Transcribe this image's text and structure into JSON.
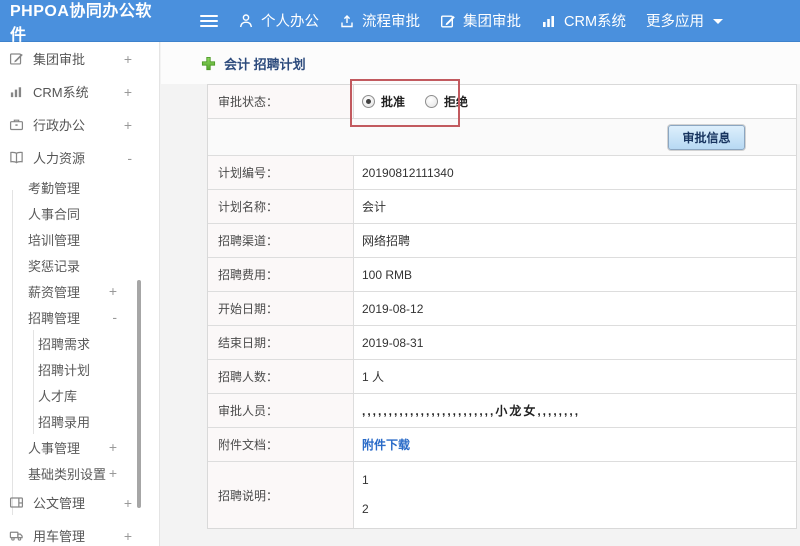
{
  "colors": {
    "header_blue": "#4a90dd",
    "annotation_red": "#c25a5f",
    "link_blue": "#2a6bc8",
    "button_text": "#17345f"
  },
  "header": {
    "logo": "PHPOA协同办公软件",
    "nav": [
      {
        "label": "个人办公",
        "icon": "user-icon"
      },
      {
        "label": "流程审批",
        "icon": "workflow-icon"
      },
      {
        "label": "集团审批",
        "icon": "edit-icon"
      },
      {
        "label": "CRM系统",
        "icon": "barchart-icon"
      },
      {
        "label": "更多应用",
        "icon": "caret-down-icon"
      }
    ]
  },
  "sidebar": {
    "items": [
      {
        "label": "集团审批",
        "icon": "edit-icon",
        "toggle": "+"
      },
      {
        "label": "CRM系统",
        "icon": "barchart-icon",
        "toggle": "+"
      },
      {
        "label": "行政办公",
        "icon": "briefcase-icon",
        "toggle": "+"
      },
      {
        "label": "人力资源",
        "icon": "book-icon",
        "toggle": "-",
        "children": [
          {
            "label": "考勤管理"
          },
          {
            "label": "人事合同"
          },
          {
            "label": "培训管理"
          },
          {
            "label": "奖惩记录"
          },
          {
            "label": "薪资管理",
            "toggle": "+"
          },
          {
            "label": "招聘管理",
            "toggle": "-",
            "children": [
              {
                "label": "招聘需求"
              },
              {
                "label": "招聘计划"
              },
              {
                "label": "人才库"
              },
              {
                "label": "招聘录用"
              }
            ]
          },
          {
            "label": "人事管理",
            "toggle": "+"
          },
          {
            "label": "基础类别设置",
            "toggle": "+"
          }
        ]
      },
      {
        "label": "公文管理",
        "icon": "document-icon",
        "toggle": "+"
      },
      {
        "label": "用车管理",
        "icon": "truck-icon",
        "toggle": "+"
      }
    ]
  },
  "main": {
    "title": "会计 招聘计划",
    "approval": {
      "label": "审批状态：",
      "options": [
        {
          "label": "批准",
          "checked": true
        },
        {
          "label": "拒绝",
          "checked": false
        }
      ]
    },
    "approve_info_button": "审批信息",
    "fields": [
      {
        "label": "计划编号：",
        "value": "20190812111340"
      },
      {
        "label": "计划名称：",
        "value": "会计"
      },
      {
        "label": "招聘渠道：",
        "value": "网络招聘"
      },
      {
        "label": "招聘费用：",
        "value": "100 RMB"
      },
      {
        "label": "开始日期：",
        "value": "2019-08-12"
      },
      {
        "label": "结束日期：",
        "value": "2019-08-31"
      },
      {
        "label": "招聘人数：",
        "value": "1 人"
      },
      {
        "label": "审批人员：",
        "value": ",,,,,,,,,,,,,,,,,,,,,,,,,小龙女,,,,,,,,"
      },
      {
        "label": "附件文档：",
        "value": "附件下载"
      },
      {
        "label": "招聘说明：",
        "line1": "1",
        "line2": "2"
      }
    ]
  }
}
